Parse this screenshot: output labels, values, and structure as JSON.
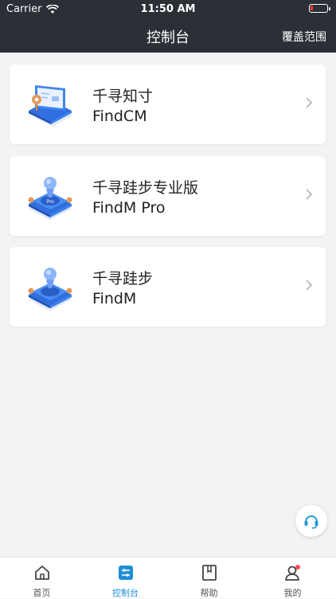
{
  "status_bar": {
    "carrier": "Carrier",
    "time": "11:50 AM"
  },
  "nav": {
    "title": "控制台",
    "right_action": "覆盖范围"
  },
  "products": [
    {
      "name": "千寻知寸",
      "subtitle": "FindCM",
      "icon": "laptop-device-illustration"
    },
    {
      "name": "千寻跬步专业版",
      "subtitle": "FindM Pro",
      "icon": "pro-positioning-illustration"
    },
    {
      "name": "千寻跬步",
      "subtitle": "FindM",
      "icon": "positioning-illustration"
    }
  ],
  "fab": {
    "icon": "headset-icon"
  },
  "tabbar": {
    "items": [
      {
        "label": "首页",
        "icon": "home-icon"
      },
      {
        "label": "控制台",
        "icon": "console-icon"
      },
      {
        "label": "帮助",
        "icon": "help-book-icon"
      },
      {
        "label": "我的",
        "icon": "profile-icon"
      }
    ],
    "active_index": 1
  },
  "colors": {
    "header_bg": "#2b2f36",
    "accent": "#1e8fd6",
    "page_bg": "#f2f3f5"
  }
}
